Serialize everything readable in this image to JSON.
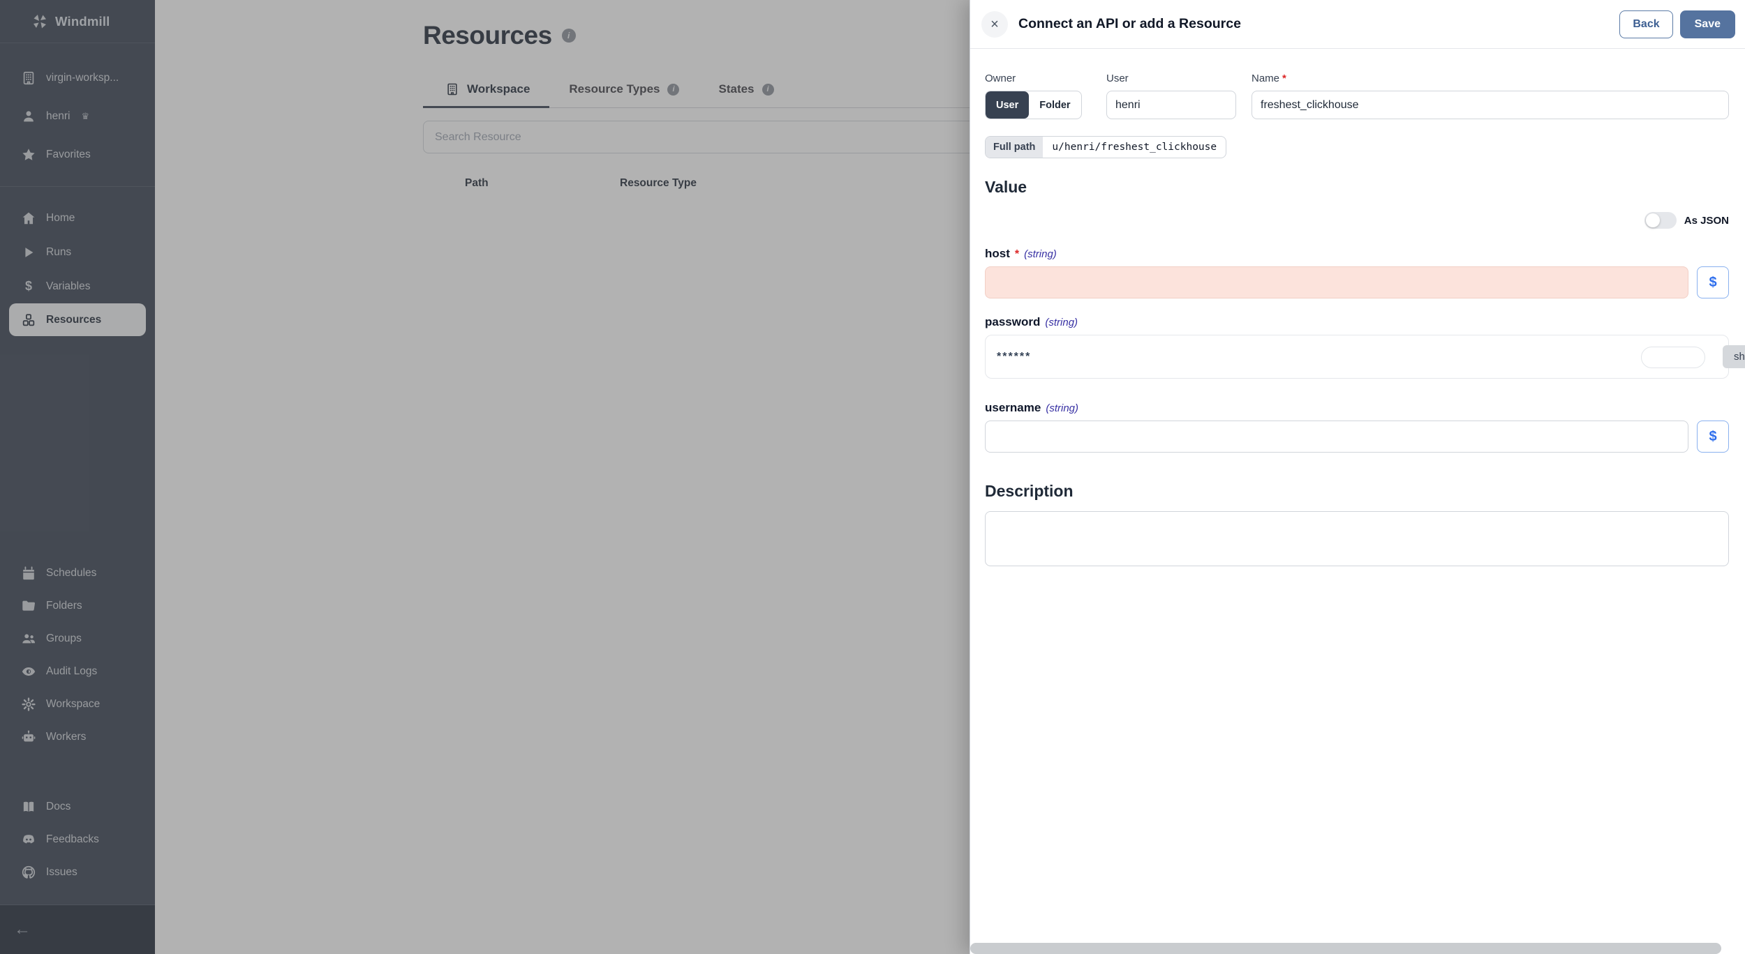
{
  "glyphs": {
    "info": "i",
    "close": "×",
    "collapse_arrow": "←",
    "crown": "♛",
    "dollar": "$"
  },
  "colors": {
    "sidebar_bg": "#374151",
    "sidebar_active_bg": "#f3f4f6",
    "save_button": "#55739f",
    "invalid_field_bg": "#fce3dc",
    "dollar_blue": "#2f6fed",
    "type_indigo": "#3730a3",
    "required_red": "#dc2626"
  },
  "sidebar": {
    "brand": "Windmill",
    "top_items": [
      {
        "label": "virgin-worksp...",
        "icon": "building-icon"
      },
      {
        "label": "henri",
        "badge": "♛",
        "icon": "user-icon"
      },
      {
        "label": "Favorites",
        "icon": "star-icon"
      }
    ],
    "nav_items": [
      {
        "label": "Home",
        "icon": "home-icon",
        "active": false
      },
      {
        "label": "Runs",
        "icon": "play-icon",
        "active": false
      },
      {
        "label": "Variables",
        "icon": "dollar-icon",
        "active": false
      },
      {
        "label": "Resources",
        "icon": "cubes-icon",
        "active": true
      }
    ],
    "admin_items": [
      {
        "label": "Schedules",
        "icon": "calendar-icon"
      },
      {
        "label": "Folders",
        "icon": "folder-icon"
      },
      {
        "label": "Groups",
        "icon": "users-icon"
      },
      {
        "label": "Audit Logs",
        "icon": "eye-icon"
      },
      {
        "label": "Workspace",
        "icon": "gear-icon"
      },
      {
        "label": "Workers",
        "icon": "robot-icon"
      }
    ],
    "link_items": [
      {
        "label": "Docs",
        "icon": "book-icon"
      },
      {
        "label": "Feedbacks",
        "icon": "discord-icon"
      },
      {
        "label": "Issues",
        "icon": "github-icon"
      }
    ]
  },
  "main": {
    "title": "Resources",
    "tabs": [
      {
        "label": "Workspace",
        "active": true,
        "icon": "building-icon"
      },
      {
        "label": "Resource Types",
        "active": false,
        "has_info": true
      },
      {
        "label": "States",
        "active": false,
        "has_info": true
      }
    ],
    "search_placeholder": "Search Resource",
    "table": {
      "columns": [
        "Path",
        "Resource Type"
      ]
    }
  },
  "drawer": {
    "title": "Connect an API or add a Resource",
    "back_label": "Back",
    "save_label": "Save",
    "owner": {
      "label": "Owner",
      "options": [
        "User",
        "Folder"
      ],
      "selected": "User"
    },
    "user_field": {
      "label": "User",
      "value": "henri"
    },
    "name_field": {
      "label": "Name",
      "required_mark": "*",
      "value": "freshest_clickhouse"
    },
    "full_path": {
      "label": "Full path",
      "value": "u/henri/freshest_clickhouse"
    },
    "value_section": {
      "heading": "Value",
      "as_json_label": "As JSON",
      "as_json_on": false
    },
    "fields": [
      {
        "name": "host",
        "required_mark": "*",
        "type_label": "(string)",
        "value": "",
        "invalid": true
      },
      {
        "name": "password",
        "type_label": "(string)",
        "value": "******",
        "show_label": "sh"
      },
      {
        "name": "username",
        "type_label": "(string)",
        "value": ""
      }
    ],
    "description": {
      "heading": "Description",
      "value": ""
    }
  }
}
